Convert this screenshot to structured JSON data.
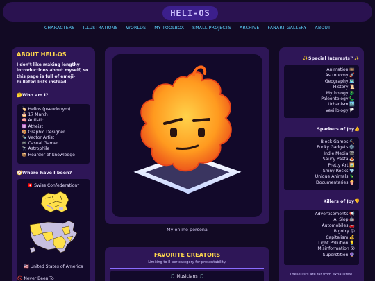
{
  "site": {
    "logo": "HELI-OS"
  },
  "nav": [
    "CHARACTERS",
    "ILLUSTRATIONS",
    "WORLDS",
    "MY TOOLBOX",
    "SMALL PROJECTS",
    "ARCHIVE",
    "FANART GALLERY",
    "ABOUT"
  ],
  "about": {
    "title": "ABOUT HELI-OS",
    "text": "I don't like making lengthy introductions about myself, so this page is full of emoji-bulleted lists instead.",
    "who_heading": "🤔Who am I?",
    "who_items": [
      "🏷️ Helios (pseudonym)",
      "🎂 17 March",
      "🧠 Autistic",
      "⚛️ Atheist",
      "🎨 Graphic Designer",
      "✒️ Vector Artist",
      "🎮 Casual Gamer",
      "🔭 Astrophile",
      "📦 Hoarder of knowledge"
    ],
    "where_heading": "🧭Where have I been?",
    "swiss": "🇨🇭 Swiss Confederation*",
    "us": "🇺🇸 United States of America",
    "never": "🚫 Never Been To"
  },
  "persona": {
    "caption": "My online persona"
  },
  "creators": {
    "title": "FAVORITE CREATORS",
    "note": "Limiting to 8 per category for presentability.",
    "musicians": "🎵 Musicians 🎵"
  },
  "interests": {
    "heading": "✨Special Interests™✨",
    "items": [
      "Animation 🎞️",
      "Astronomy 🚀",
      "Geography 🗺️",
      "History 📜",
      "Mythology 🐉",
      "Paleontology 🦕",
      "Urbanism 🏙️",
      "Vexillology 🏳️"
    ]
  },
  "sparkers": {
    "heading": "Sparkers of Joy👍",
    "items": [
      "Block Games ⛏️",
      "Funky Gadgets ⚙️",
      "Indie Media 🎬",
      "Saucy Pasta 🍝",
      "Pretty Art 🖼️",
      "Shiny Rocks 💎",
      "Unique Animals 🦎",
      "Documentaries 🍿"
    ]
  },
  "killers": {
    "heading": "Killers of Joy👎",
    "items": [
      "Advertisements 📢",
      "AI Slop 🤖",
      "Automobiles 🚗",
      "Bigotry 😡",
      "Capitalism 💰",
      "Light Pollution 💡",
      "Misinformation 😵",
      "Superstition 🔮"
    ]
  },
  "footnote": "These lists are far from exhaustive.",
  "colors": {
    "accent_yellow": "#ffd84d",
    "nav_cyan": "#5fd4ff",
    "panel": "#2e1657",
    "inner": "#12092a",
    "rule": "#8a6cff"
  }
}
